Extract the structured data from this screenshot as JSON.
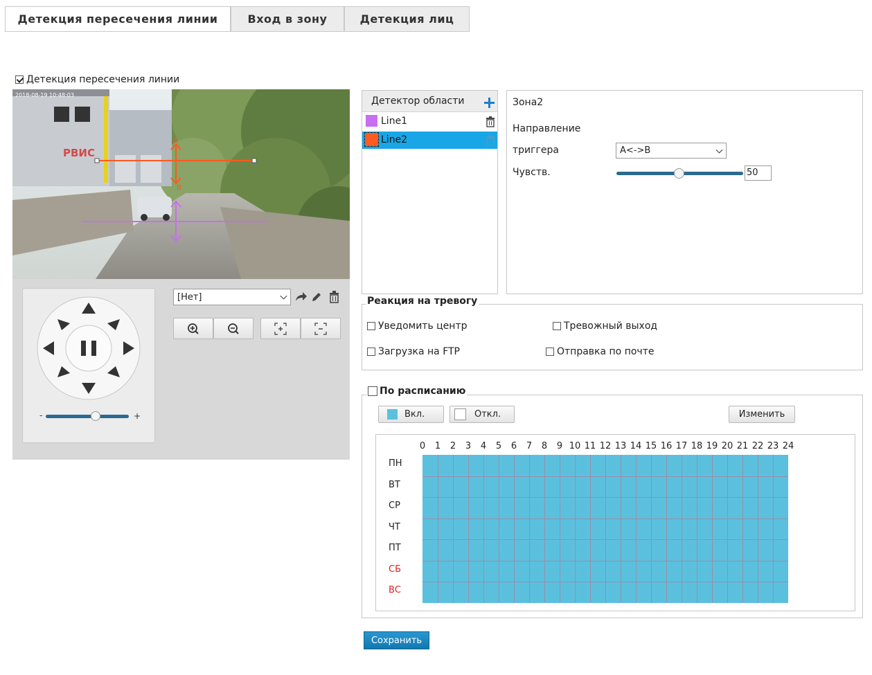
{
  "tabs": [
    {
      "label": "Детекция пересечения линии",
      "active": true
    },
    {
      "label": "Вход в зону",
      "active": false
    },
    {
      "label": "Детекция лиц",
      "active": false
    }
  ],
  "enable_checkbox": {
    "label": "Детекция пересечения линии",
    "checked": true
  },
  "video": {
    "osd_text": "2018-08-19 10:48:03",
    "sign_text": "РВИС",
    "line1_color": "#c86ef0",
    "line2_color": "#ff5a1f",
    "label_a": "A",
    "label_b": "B"
  },
  "ptz": {
    "preset_value": "[Нет]",
    "zoom_in_icon": "zoom-in-icon",
    "zoom_out_icon": "zoom-out-icon",
    "speed_minus": "-",
    "speed_plus": "+",
    "speed_level": 0.55
  },
  "detector": {
    "header": "Детектор области",
    "items": [
      {
        "label": "Line1",
        "color": "#c86ef0",
        "selected": false
      },
      {
        "label": "Line2",
        "color": "#ff5a1f",
        "selected": true
      }
    ]
  },
  "zone": {
    "title": "Зона2",
    "direction_label": "Направление",
    "trigger_label": "триггера",
    "trigger_value": "A<->B",
    "sens_label": "Чувств.",
    "sens_value": "50",
    "sens_level": 0.5
  },
  "alarm": {
    "legend": "Реакция на тревогу",
    "options": [
      {
        "label": "Уведомить центр",
        "checked": false
      },
      {
        "label": "Тревожный выход",
        "checked": false
      },
      {
        "label": "Загрузка на FTP",
        "checked": false
      },
      {
        "label": "Отправка по почте",
        "checked": false
      }
    ]
  },
  "schedule": {
    "legend": "По расписанию",
    "checked": false,
    "on_label": "Вкл.",
    "off_label": "Откл.",
    "edit_label": "Изменить",
    "on_color": "#5bc0de",
    "hours": [
      "0",
      "1",
      "2",
      "3",
      "4",
      "5",
      "6",
      "7",
      "8",
      "9",
      "10",
      "11",
      "12",
      "13",
      "14",
      "15",
      "16",
      "17",
      "18",
      "19",
      "20",
      "21",
      "22",
      "23",
      "24"
    ],
    "days": [
      {
        "label": "ПН",
        "weekend": false
      },
      {
        "label": "ВТ",
        "weekend": false
      },
      {
        "label": "СР",
        "weekend": false
      },
      {
        "label": "ЧТ",
        "weekend": false
      },
      {
        "label": "ПТ",
        "weekend": false
      },
      {
        "label": "СБ",
        "weekend": true
      },
      {
        "label": "ВС",
        "weekend": true
      }
    ]
  },
  "save_label": "Сохранить"
}
